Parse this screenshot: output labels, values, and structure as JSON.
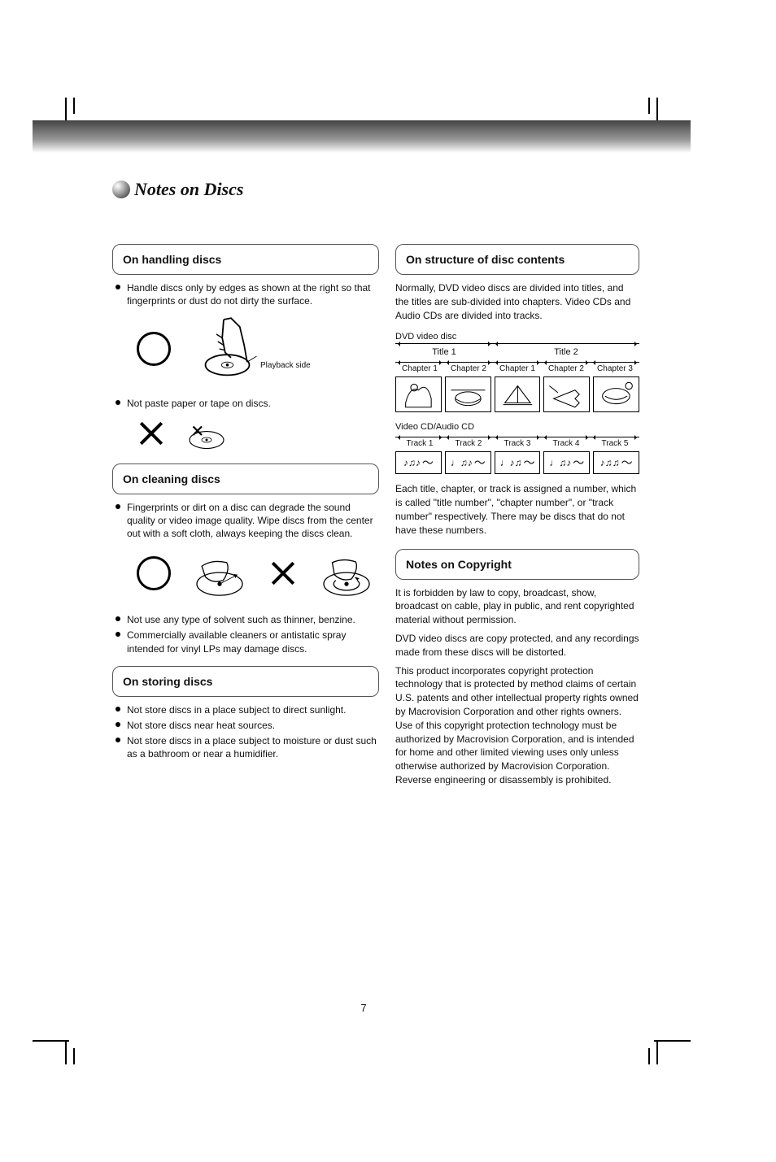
{
  "page_title": "Notes on Discs",
  "page_number": "7",
  "left": {
    "sec1": {
      "heading": "On handling discs",
      "bullet1": "Handle discs only by edges as shown at the right so that fingerprints or dust do not dirty the surface.",
      "playback_side_label": "Playback side",
      "bullet2": "Not paste paper or tape on discs."
    },
    "sec2": {
      "heading": "On cleaning discs",
      "bullet1": "Fingerprints or dirt on a disc can degrade the sound quality or video image quality. Wipe discs from the center out with a soft cloth, always keeping the discs clean.",
      "bullet2": "Not use any type of solvent such as thinner, benzine.",
      "bullet3": "Commercially available cleaners or antistatic spray intended for vinyl LPs may damage discs."
    },
    "sec3": {
      "heading": "On storing discs",
      "bullet1": "Not store discs in a place subject to direct sunlight.",
      "bullet2": "Not store discs near heat sources.",
      "bullet3": "Not store discs in a place subject to moisture or dust such as a bathroom or near a humidifier."
    }
  },
  "right": {
    "sec1": {
      "heading": "On structure of disc contents",
      "para": "Normally, DVD video discs are divided into titles, and the titles are sub-divided into chapters. Video CDs and Audio CDs are divided into tracks.",
      "dvd_label": "DVD video disc",
      "title1": "Title 1",
      "title2": "Title 2",
      "chapter1": "Chapter 1",
      "chapter2": "Chapter 2",
      "chapter3": "Chapter 1",
      "chapter4": "Chapter 2",
      "chapter5": "Chapter 3",
      "cd_label": "Video CD/Audio CD",
      "track1": "Track 1",
      "track2": "Track 2",
      "track3": "Track 3",
      "track4": "Track 4",
      "track5": "Track 5",
      "para2": "Each title, chapter, or track is assigned a number, which is called \"title number\", \"chapter number\", or \"track number\" respectively. There may be discs that do not have these numbers."
    },
    "sec2": {
      "heading": "Notes on Copyright",
      "para1": "It is forbidden by law to copy, broadcast, show, broadcast on cable, play in public, and rent copyrighted material without permission.",
      "para2": "DVD video discs are copy protected, and any recordings made from these discs will be distorted.",
      "para3": "This product incorporates copyright protection technology that is protected by method claims of certain U.S. patents and other intellectual property rights owned by Macrovision Corporation and other rights owners. Use of this copyright protection technology must be authorized by Macrovision Corporation, and is intended for home and other limited viewing uses only unless otherwise authorized by Macrovision Corporation. Reverse engineering or disassembly is prohibited."
    }
  }
}
